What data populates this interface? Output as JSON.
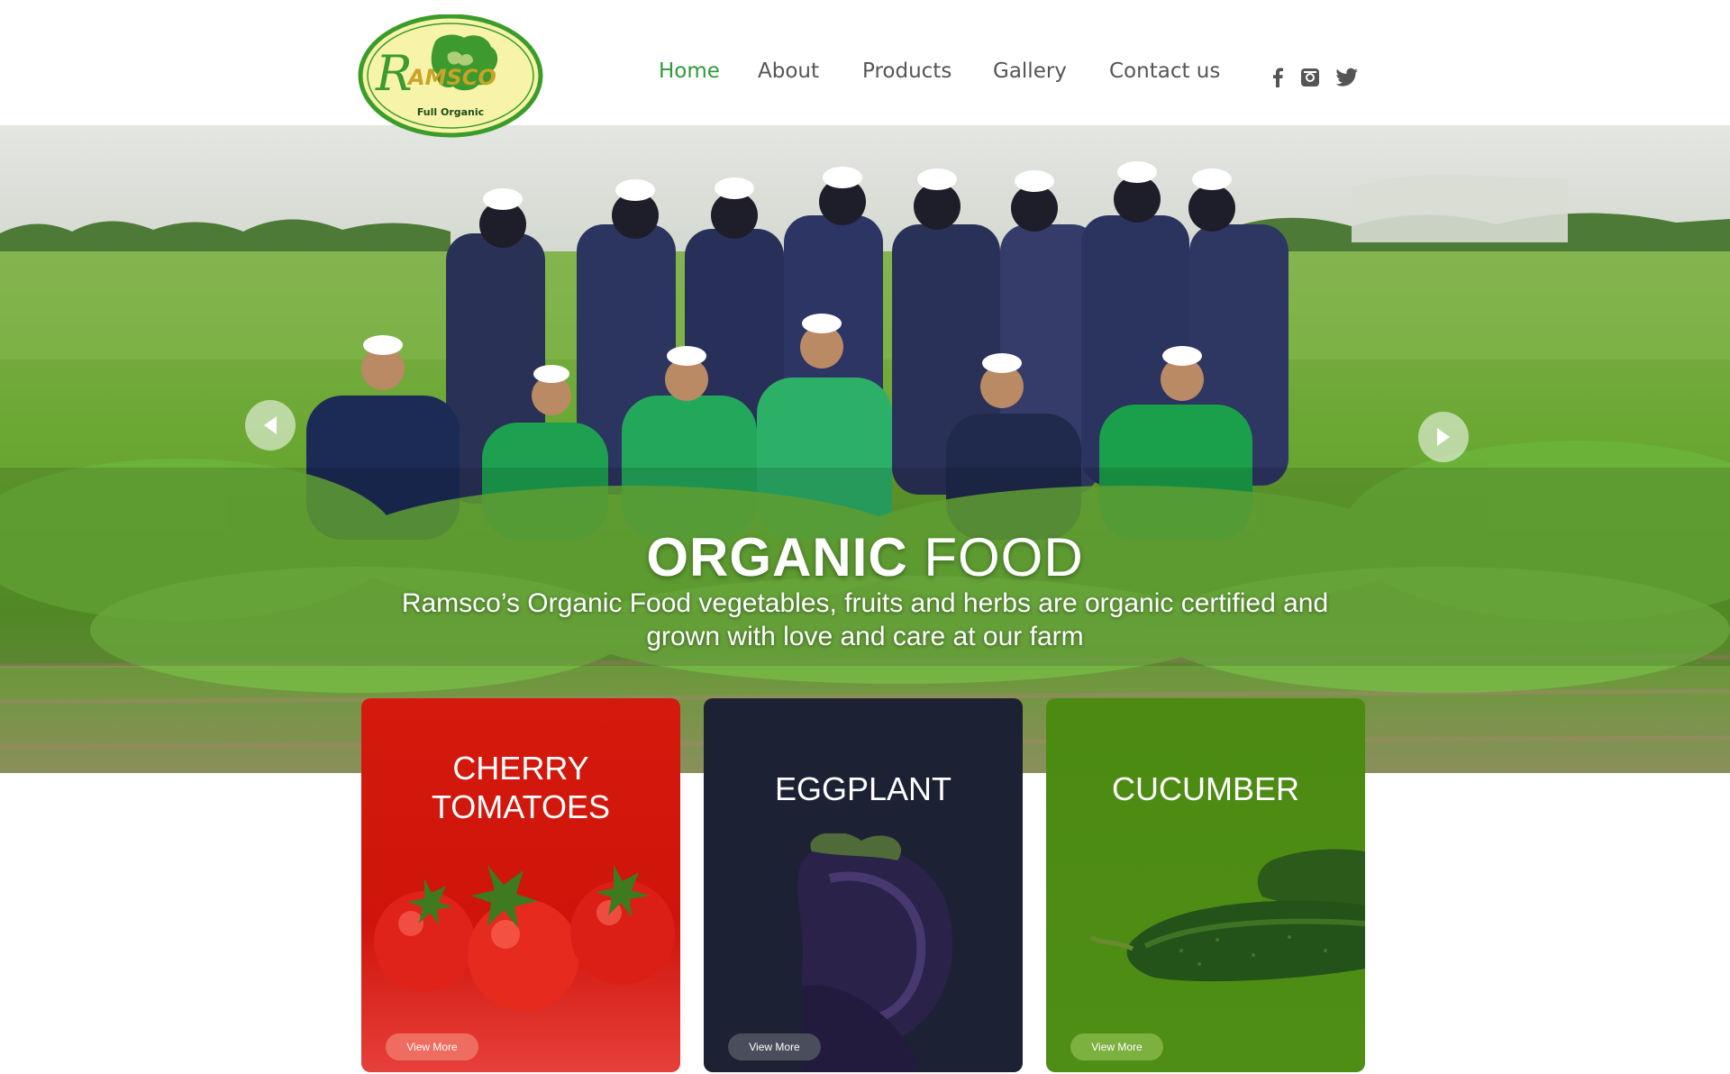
{
  "brand": {
    "logo_text": "RAMSCO",
    "logo_tagline": "Full Organic"
  },
  "nav": {
    "items": [
      {
        "label": "Home",
        "active": true
      },
      {
        "label": "About"
      },
      {
        "label": "Products"
      },
      {
        "label": "Gallery"
      },
      {
        "label": "Contact us"
      }
    ],
    "social": [
      "facebook-icon",
      "instagram-icon",
      "twitter-icon"
    ]
  },
  "hero": {
    "title_bold": "ORGANIC",
    "title_light": "FOOD",
    "subtitle": "Ramsco’s Organic Food vegetables, fruits and herbs are organic certified and grown with love and care at our farm"
  },
  "cards": [
    {
      "title": "CHERRY TOMATOES",
      "button": "View More"
    },
    {
      "title": "EGGPLANT",
      "button": "View More"
    },
    {
      "title": "CUCUMBER",
      "button": "View More"
    }
  ],
  "colors": {
    "accent": "#2e9a3a",
    "nav_text": "#555555",
    "tomato_card": "#d41a0c",
    "eggplant_card": "#1d2134",
    "cucumber_card": "#4c8a12"
  }
}
